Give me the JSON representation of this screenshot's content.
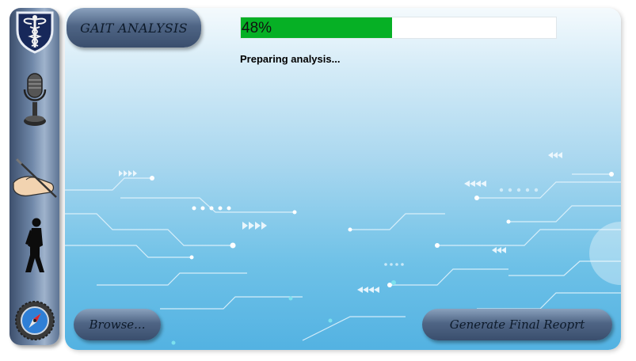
{
  "app": {
    "title": "GAIT ANALYSIS"
  },
  "progress": {
    "percent": 48,
    "label": "48%",
    "fill_color": "#06b025"
  },
  "status": {
    "text": "Preparing analysis..."
  },
  "buttons": {
    "browse_label": "Browse...",
    "report_label": "Generate Final Reoprt"
  },
  "sidebar": {
    "items": [
      {
        "icon": "medical-caduceus-icon"
      },
      {
        "icon": "microphone-icon"
      },
      {
        "icon": "hand-writing-icon"
      },
      {
        "icon": "walking-person-icon"
      },
      {
        "icon": "compass-icon"
      }
    ]
  },
  "colors": {
    "sidebar": "#5d7494",
    "background_top": "#f4fafd",
    "background_bottom": "#53b2e2",
    "pill": "#4f6585"
  }
}
